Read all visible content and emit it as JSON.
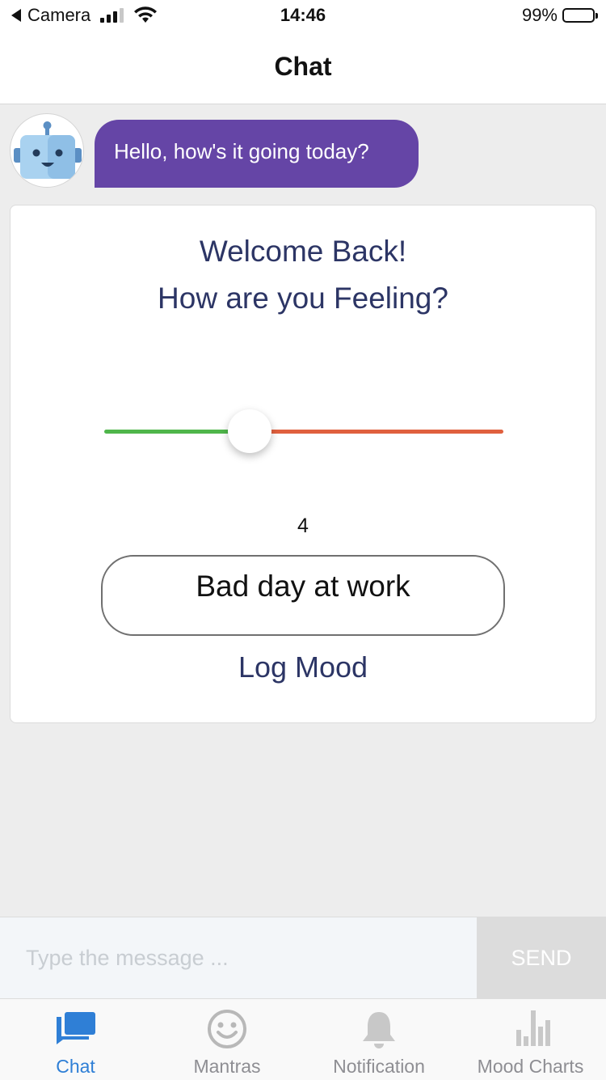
{
  "status_bar": {
    "back_app": "Camera",
    "time": "14:46",
    "battery": "99%"
  },
  "nav": {
    "title": "Chat"
  },
  "chat": {
    "bot_message": "Hello, how's it going today?",
    "avatar_icon": "robot-icon"
  },
  "mood_card": {
    "welcome": "Welcome Back!",
    "question": "How are you Feeling?",
    "slider": {
      "value": 4,
      "value_label": "4",
      "min_color": "#4fb64b",
      "max_color": "#e0603e"
    },
    "note": "Bad day at work",
    "log_label": "Log Mood"
  },
  "composer": {
    "placeholder": "Type the message ...",
    "send_label": "SEND"
  },
  "tabs": [
    {
      "label": "Chat",
      "icon": "chat-icon",
      "active": true
    },
    {
      "label": "Mantras",
      "icon": "smiley-icon",
      "active": false
    },
    {
      "label": "Notification",
      "icon": "bell-icon",
      "active": false
    },
    {
      "label": "Mood Charts",
      "icon": "bar-chart-icon",
      "active": false
    }
  ],
  "colors": {
    "accent": "#2f7fd6",
    "bubble": "#6545a6",
    "heading": "#2c3565"
  }
}
